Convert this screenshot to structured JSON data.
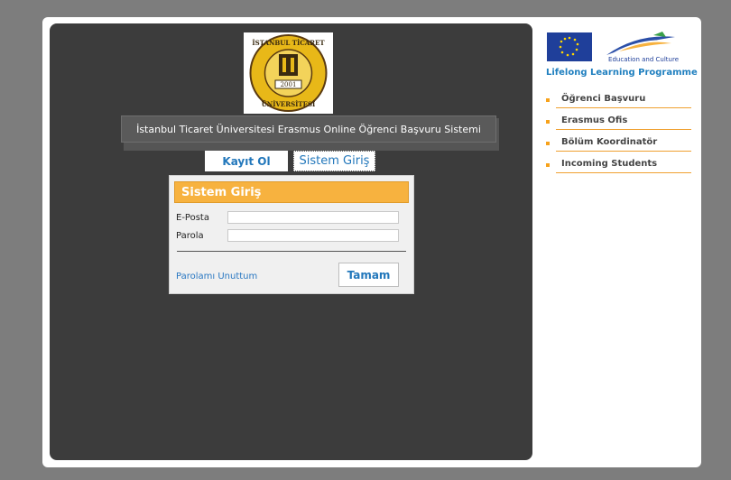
{
  "university_logo": {
    "ring_text_top": "İSTANBUL TİCARET",
    "ring_text_bottom": "ÜNİVERSİTESİ",
    "year": "2001"
  },
  "header": {
    "title": "İstanbul Ticaret Üniversitesi Erasmus Online Öğrenci Başvuru Sistemi"
  },
  "tabs": {
    "register": "Kayıt Ol",
    "login": "Sistem Giriş"
  },
  "login_form": {
    "title": "Sistem Giriş",
    "email_label": "E-Posta",
    "email_value": "",
    "password_label": "Parola",
    "password_value": "",
    "forgot_link": "Parolamı Unuttum",
    "submit_label": "Tamam"
  },
  "sidebar": {
    "eu_logo": {
      "caption": "Education and Culture"
    },
    "programme_name": "Lifelong Learning Programme",
    "items": [
      {
        "label": "Öğrenci Başvuru"
      },
      {
        "label": "Erasmus Ofis"
      },
      {
        "label": "Bölüm Koordinatör"
      },
      {
        "label": "Incoming Students"
      }
    ]
  },
  "colors": {
    "background": "#7d7d7d",
    "panel": "#3c3c3c",
    "accent_orange": "#f7b23f",
    "link_blue": "#2277bb"
  }
}
